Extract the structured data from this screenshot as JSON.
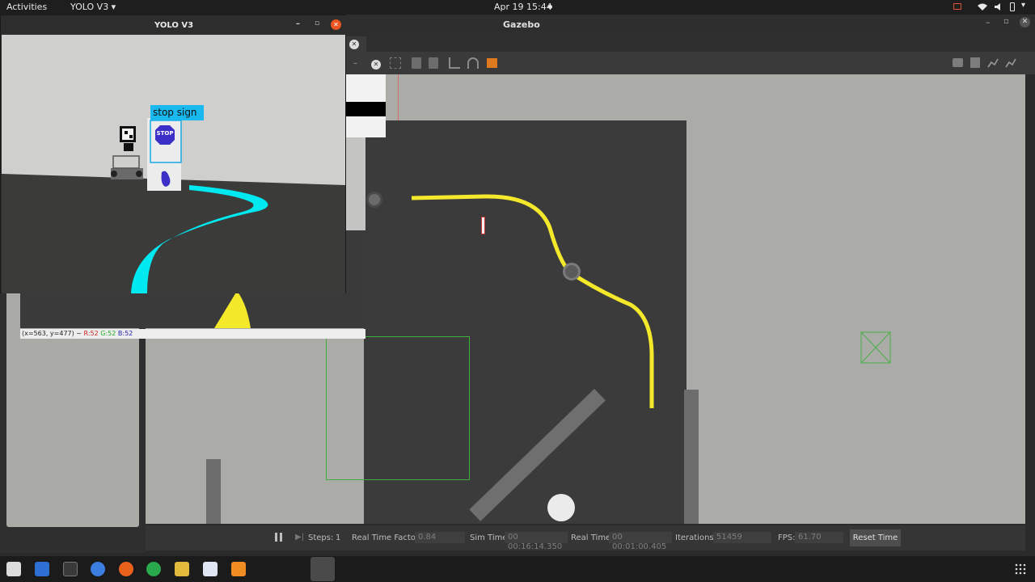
{
  "topbar": {
    "activities": "Activities",
    "app_menu": "YOLO V3 ▾",
    "clock": "Apr 19  15:44"
  },
  "gazebo": {
    "title": "Gazebo",
    "bottom": {
      "steps_label": "Steps:",
      "steps_value": "1",
      "rtf_label": "Real Time Factor:",
      "rtf_value": "0.84",
      "sim_time_label": "Sim Time:",
      "sim_time_value": "00 00:16:14.350",
      "real_time_label": "Real Time:",
      "real_time_value": "00 00:01:00.405",
      "iterations_label": "Iterations:",
      "iterations_value": "51459",
      "fps_label": "FPS:",
      "fps_value": "61.70",
      "reset_label": "Reset Time"
    }
  },
  "yolo_window": {
    "title": "YOLO V3",
    "detection_label": "stop  sign",
    "stop_text": "STOP"
  },
  "camera_window": {
    "status_coords": "(x=563, y=477) ~",
    "status_r": "R:52",
    "status_g": "G:52",
    "status_b": "B:52"
  }
}
